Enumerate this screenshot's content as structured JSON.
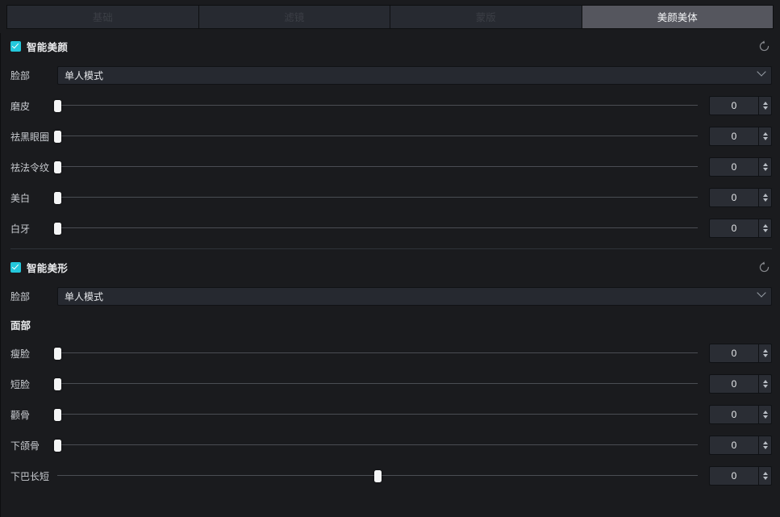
{
  "tabs": [
    {
      "label": "基础",
      "active": false
    },
    {
      "label": "滤镜",
      "active": false
    },
    {
      "label": "蒙版",
      "active": false
    },
    {
      "label": "美颜美体",
      "active": true
    }
  ],
  "beauty_section": {
    "title": "智能美颜",
    "enabled": true,
    "reset_icon": "reset-circular-arrow-icon",
    "face_label": "脸部",
    "face_mode": "单人模式",
    "chevron_icon": "chevron-down-icon",
    "sliders": [
      {
        "label": "磨皮",
        "value": "0",
        "pos": 0
      },
      {
        "label": "祛黑眼圈",
        "value": "0",
        "pos": 0
      },
      {
        "label": "祛法令纹",
        "value": "0",
        "pos": 0
      },
      {
        "label": "美白",
        "value": "0",
        "pos": 0
      },
      {
        "label": "白牙",
        "value": "0",
        "pos": 0
      }
    ]
  },
  "shape_section": {
    "title": "智能美形",
    "enabled": true,
    "reset_icon": "reset-circular-arrow-icon",
    "face_label": "脸部",
    "face_mode": "单人模式",
    "chevron_icon": "chevron-down-icon",
    "subhead": "面部",
    "sliders": [
      {
        "label": "瘦脸",
        "value": "0",
        "pos": 0
      },
      {
        "label": "短脸",
        "value": "0",
        "pos": 0
      },
      {
        "label": "颧骨",
        "value": "0",
        "pos": 0
      },
      {
        "label": "下颌骨",
        "value": "0",
        "pos": 0
      },
      {
        "label": "下巴长短",
        "value": "0",
        "pos": 50
      }
    ]
  },
  "colors": {
    "background": "#1a1b1e",
    "tab_inactive_bg": "#272a31",
    "tab_active_bg": "#55565e",
    "checkbox_accent": "#24c8dc",
    "knob": "#f4f5f6",
    "track": "#4a4d53"
  }
}
